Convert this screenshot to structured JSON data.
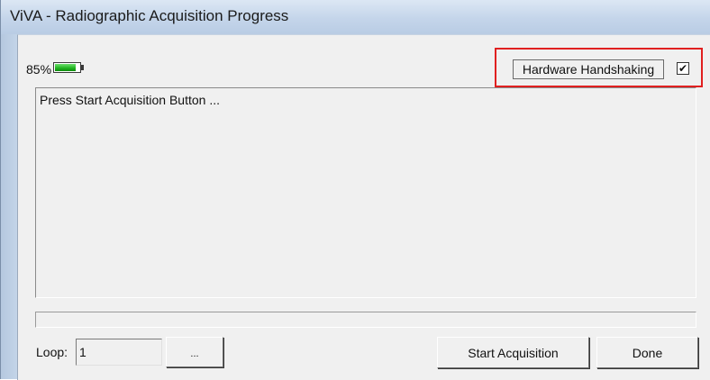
{
  "window": {
    "title": "ViVA - Radiographic Acquisition Progress"
  },
  "status": {
    "percent_text": "85%",
    "battery_level": 0.85,
    "battery_icon": "battery-icon",
    "battery_color": "#1fb21f"
  },
  "hardware": {
    "label": "Hardware Handshaking",
    "checked": true,
    "check_mark": "✔",
    "highlight_color": "#e02020"
  },
  "log": {
    "message": "Press Start Acquisition Button ..."
  },
  "progress": {
    "value": 0
  },
  "loop": {
    "label": "Loop:",
    "value": "1",
    "browse_label": "..."
  },
  "buttons": {
    "start_label": "Start Acquisition",
    "done_label": "Done"
  }
}
